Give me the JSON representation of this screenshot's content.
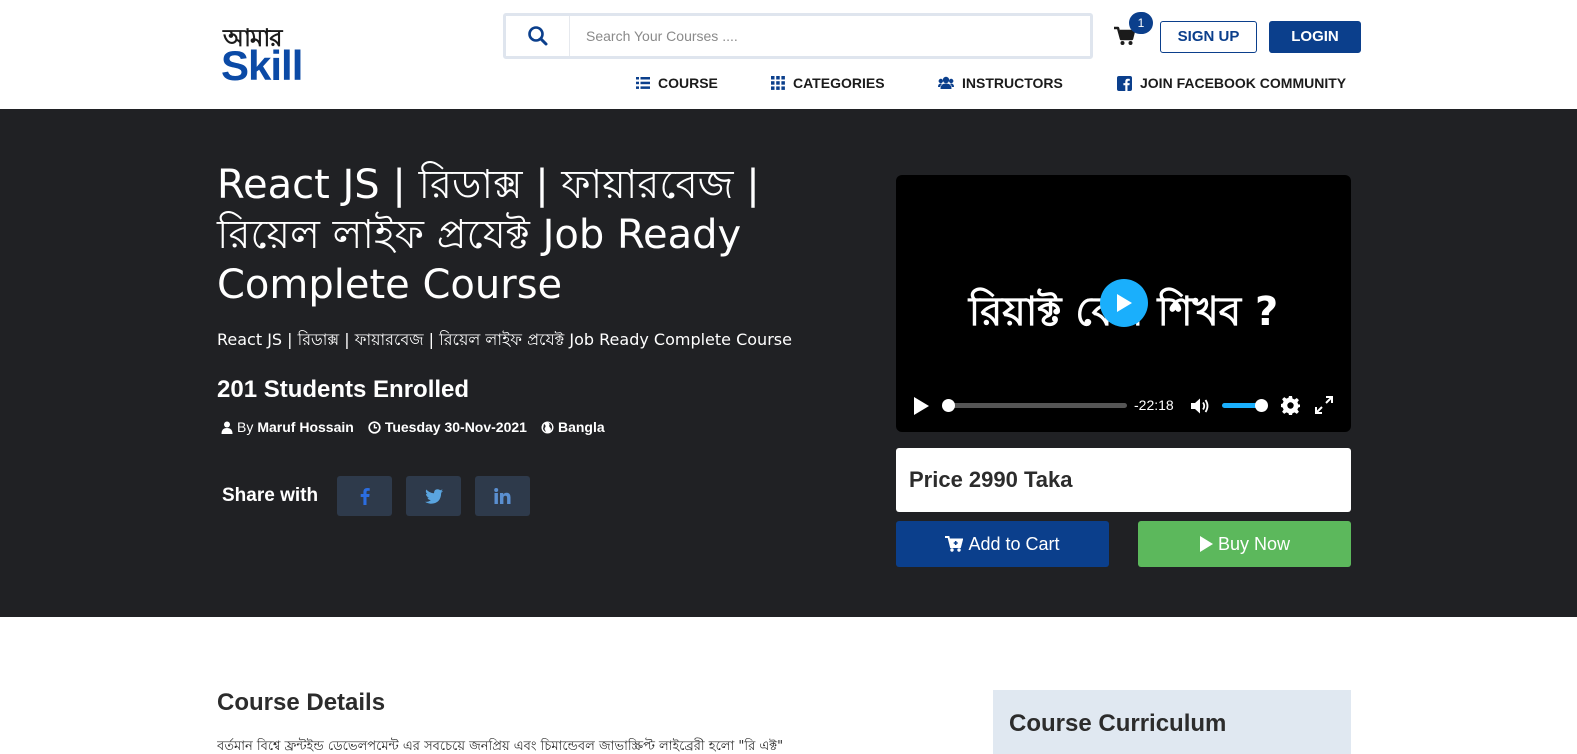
{
  "brand": {
    "logo_bn": "আমার",
    "logo_text": "Skill",
    "primary_color": "#0b3f8c"
  },
  "search": {
    "placeholder": "Search Your Courses ...."
  },
  "cart": {
    "count": "1"
  },
  "auth": {
    "signup": "SIGN UP",
    "login": "LOGIN"
  },
  "nav": [
    {
      "label": "COURSE",
      "icon": "list-icon"
    },
    {
      "label": "CATEGORIES",
      "icon": "grid-icon"
    },
    {
      "label": "INSTRUCTORS",
      "icon": "users-icon"
    },
    {
      "label": "JOIN FACEBOOK COMMUNITY",
      "icon": "facebook-icon"
    }
  ],
  "course": {
    "title": "React JS | রিডাক্স | ফায়ারবেজ | রিয়েল লাইফ প্রযেক্ট Job Ready Complete Course",
    "subtitle": "React JS | রিডাক্স | ফায়ারবেজ | রিয়েল লাইফ প্রযেক্ট Job Ready Complete Course",
    "enrolled": "201 Students Enrolled",
    "by_label": "By",
    "author": "Maruf Hossain",
    "date": "Tuesday 30-Nov-2021",
    "language": "Bangla"
  },
  "share": {
    "label": "Share with"
  },
  "video": {
    "overlay_text": "রিয়াক্ট কেন শিখব ?",
    "time": "-22:18",
    "progress": 0.0,
    "volume": 1.0,
    "accent": "#1aaffc"
  },
  "purchase": {
    "price": "Price 2990 Taka",
    "add_to_cart": "Add to Cart",
    "buy_now": "Buy Now",
    "buy_color": "#5cb85c"
  },
  "details": {
    "title": "Course Details",
    "text": "বর্তমান বিশ্বে ফ্রন্টইন্ড ডেভেলপমেন্ট এর সবচেয়ে জনপ্রিয় এবং চিমান্ডেবল জাভাস্ক্রিপ্ট লাইব্রেরী হলো \"রি এক্ট\""
  },
  "curriculum": {
    "title": "Course Curriculum"
  }
}
